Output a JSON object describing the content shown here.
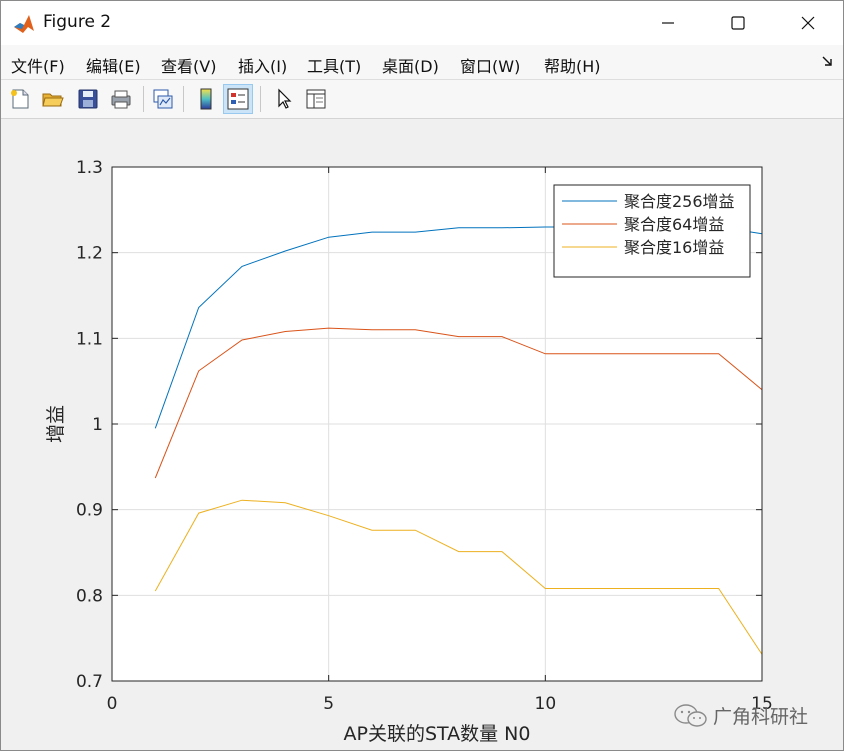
{
  "window": {
    "title": "Figure 2"
  },
  "menu": [
    "文件(F)",
    "编辑(E)",
    "查看(V)",
    "插入(I)",
    "工具(T)",
    "桌面(D)",
    "窗口(W)",
    "帮助(H)"
  ],
  "toolbar": {
    "buttons": [
      "new-figure",
      "open-file",
      "save",
      "print",
      "link-plot",
      "insert-colorbar",
      "insert-legend",
      "edit-plot-arrow",
      "property-inspector"
    ]
  },
  "colors": {
    "series1": "#0072BD",
    "series2": "#D95319",
    "series3": "#EDB120"
  },
  "chart_data": {
    "type": "line",
    "xlabel": "AP关联的STA数量 N0",
    "ylabel": "增益",
    "xlim": [
      0,
      15
    ],
    "ylim": [
      0.7,
      1.3
    ],
    "xticks": [
      "0",
      "5",
      "10",
      "15"
    ],
    "yticks": [
      "0.7",
      "0.8",
      "0.9",
      "1",
      "1.1",
      "1.2",
      "1.3"
    ],
    "grid": true,
    "legend_position": "top-right",
    "x": [
      1,
      2,
      3,
      4,
      5,
      6,
      7,
      8,
      9,
      10,
      11,
      12,
      13,
      14,
      15
    ],
    "series": [
      {
        "name": "聚合度256增益",
        "color": "#0072BD",
        "values": [
          0.995,
          1.136,
          1.184,
          1.202,
          1.218,
          1.224,
          1.224,
          1.229,
          1.229,
          1.23,
          1.23,
          1.23,
          1.23,
          1.23,
          1.222
        ]
      },
      {
        "name": "聚合度64增益",
        "color": "#D95319",
        "values": [
          0.937,
          1.062,
          1.098,
          1.108,
          1.112,
          1.11,
          1.11,
          1.102,
          1.102,
          1.082,
          1.082,
          1.082,
          1.082,
          1.082,
          1.04
        ]
      },
      {
        "name": "聚合度16增益",
        "color": "#EDB120",
        "values": [
          0.805,
          0.896,
          0.911,
          0.908,
          0.893,
          0.876,
          0.876,
          0.851,
          0.851,
          0.808,
          0.808,
          0.808,
          0.808,
          0.808,
          0.731
        ]
      }
    ]
  },
  "watermark": {
    "text": "广角科研社"
  }
}
